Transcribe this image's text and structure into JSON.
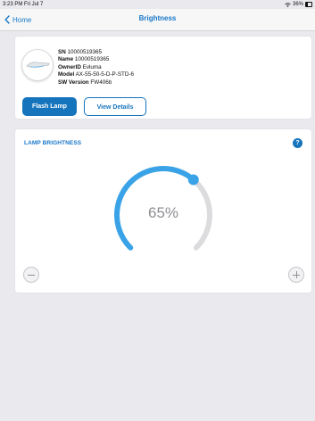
{
  "status_bar": {
    "time_date": "3:23 PM  Fri Jul 7",
    "battery": "36%"
  },
  "nav": {
    "back_label": "Home",
    "title": "Brightness"
  },
  "device": {
    "sn_label": "SN",
    "sn_value": "10000519365",
    "name_label": "Name",
    "name_value": "10000519365",
    "owner_label": "OwnerID",
    "owner_value": "Evluma",
    "model_label": "Model",
    "model_value": "AX-55-50-5-D-P-STD-6",
    "sw_label": "SW Version",
    "sw_value": "FW406b"
  },
  "actions": {
    "flash_label": "Flash Lamp",
    "details_label": "View Details"
  },
  "brightness": {
    "section_title": "LAMP BRIGHTNESS",
    "help_label": "?",
    "level_percent": 65,
    "value_text": "65%"
  },
  "colors": {
    "accent": "#1674bd",
    "gauge_active": "#3aa3e8",
    "gauge_track": "#dcdcdf"
  }
}
